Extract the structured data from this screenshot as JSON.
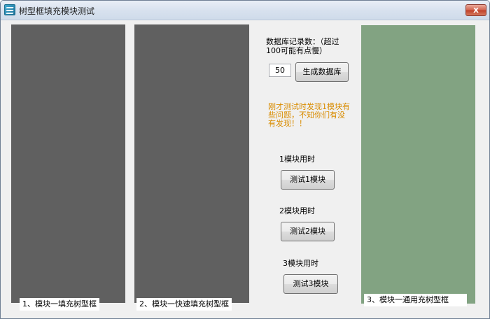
{
  "window": {
    "title": "树型框填充模块测试",
    "close_glyph": "x",
    "app_icon": "tree-app-icon"
  },
  "panels": [
    {
      "caption": "1、模块一填充树型框",
      "color": "#606060"
    },
    {
      "caption": "2、模块一快速填充树型框",
      "color": "#606060"
    },
    {
      "caption": "3、模块一通用充树型框",
      "color": "#82a382"
    }
  ],
  "controls": {
    "record_count_label": "数据库记录数：（超过100可能有点慢）",
    "record_count_value": "50",
    "generate_button": "生成数据库",
    "warning": "刚才测试时发现1模块有些问题，不知你们有没有发现！！",
    "module1_time_label": "1模块用时",
    "module1_button": "测试1模块",
    "module2_time_label": "2模块用时",
    "module2_button": "测试2模块",
    "module3_time_label": "3模块用时",
    "module3_button": "测试3模块"
  }
}
